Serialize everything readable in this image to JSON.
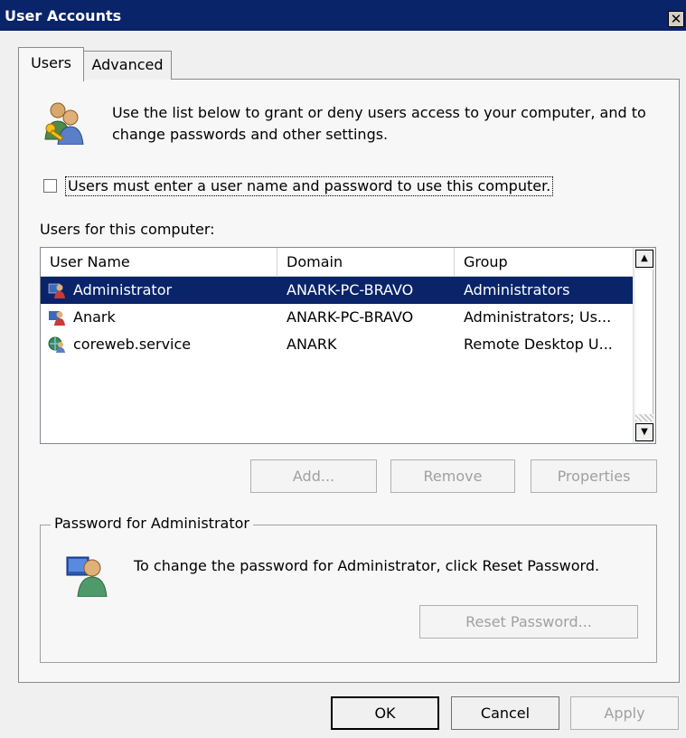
{
  "window": {
    "title": "User Accounts",
    "close_glyph": "✕"
  },
  "tabs": [
    {
      "label": "Users"
    },
    {
      "label": "Advanced"
    }
  ],
  "intro": {
    "text": "Use the list below to grant or deny users access to your computer, and to change passwords and other settings.",
    "icon": "users-icon"
  },
  "checkbox": {
    "label": "Users must enter a user name and password to use this computer.",
    "checked": false
  },
  "users_label": "Users for this computer:",
  "table": {
    "columns": [
      "User Name",
      "Domain",
      "Group"
    ],
    "rows": [
      {
        "name": "Administrator",
        "domain": "ANARK-PC-BRAVO",
        "group": "Administrators",
        "selected": true,
        "icon": "user-icon"
      },
      {
        "name": "Anark",
        "domain": "ANARK-PC-BRAVO",
        "group": "Administrators; Us...",
        "selected": false,
        "icon": "user-icon"
      },
      {
        "name": "coreweb.service",
        "domain": "ANARK",
        "group": "Remote Desktop U...",
        "selected": false,
        "icon": "domain-user-icon"
      }
    ]
  },
  "actions": {
    "add": "Add...",
    "remove": "Remove",
    "properties": "Properties"
  },
  "password": {
    "group_title": "Password for Administrator",
    "text": "To change the password for Administrator, click Reset Password.",
    "reset": "Reset Password...",
    "icon": "admin-user-icon"
  },
  "footer": {
    "ok": "OK",
    "cancel": "Cancel",
    "apply": "Apply"
  },
  "colors": {
    "title_bar": "#0a246a",
    "selection": "#0a246a"
  }
}
